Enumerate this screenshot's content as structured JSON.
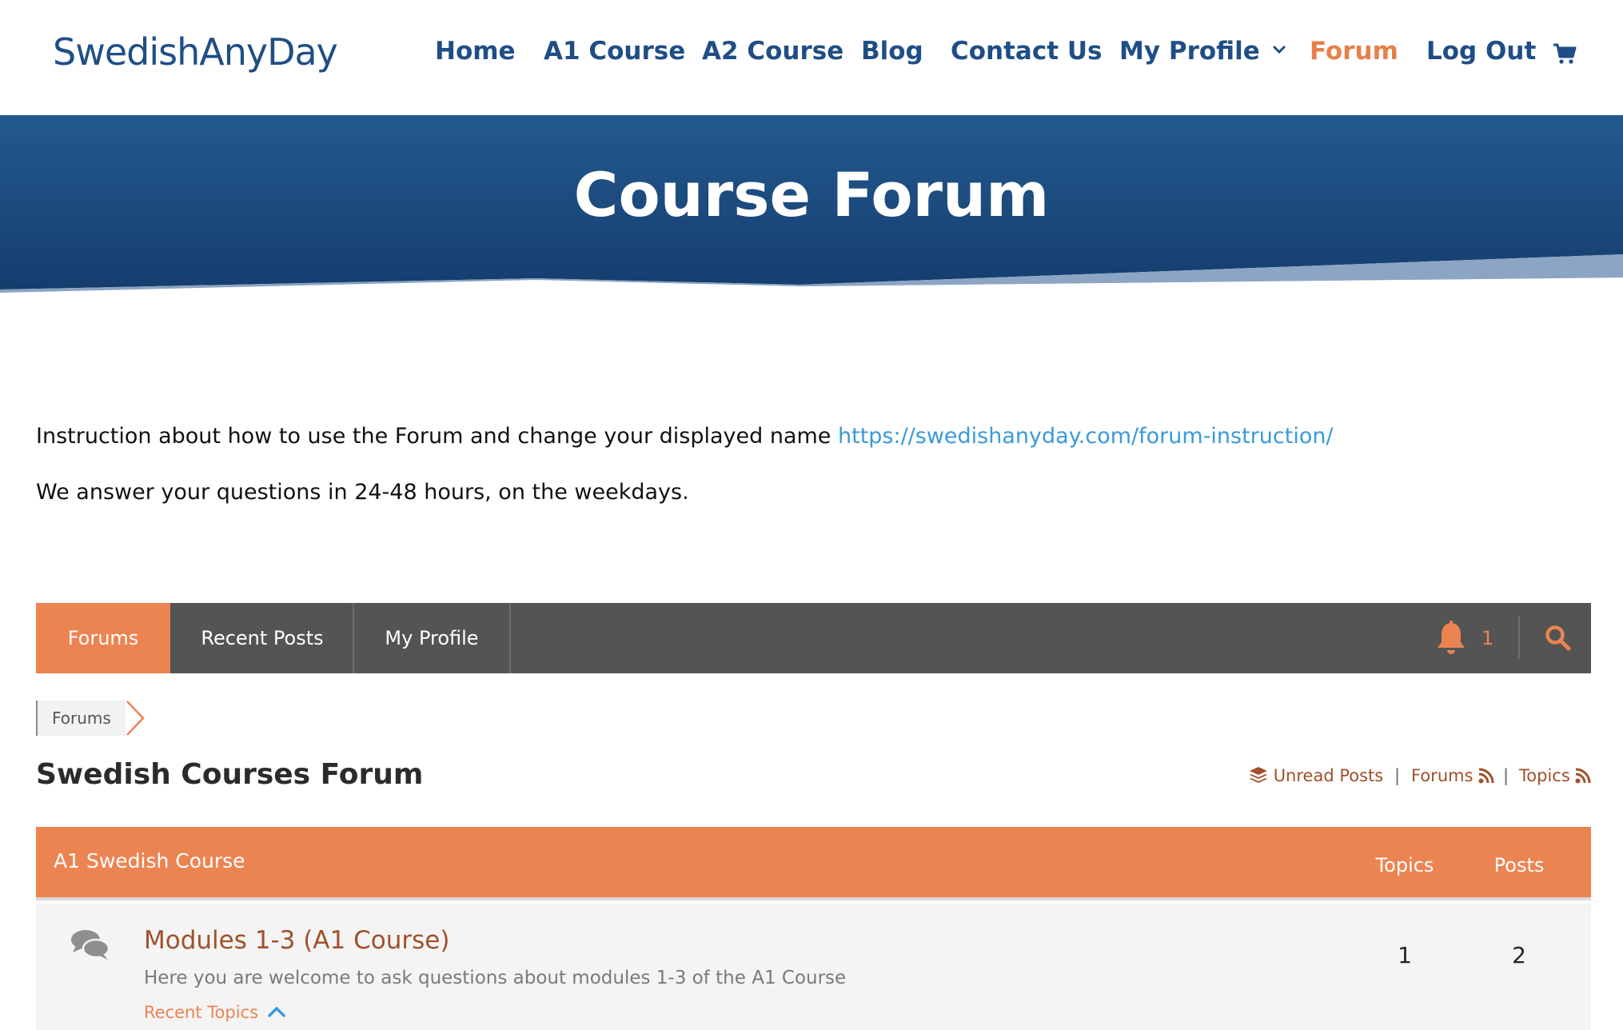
{
  "site": {
    "logo": "SwedishAnyDay"
  },
  "nav": {
    "items": [
      {
        "label": "Home"
      },
      {
        "label": "A1 Course"
      },
      {
        "label": "A2 Course"
      },
      {
        "label": "Blog"
      },
      {
        "label": "Contact Us"
      },
      {
        "label": "My Profile"
      },
      {
        "label": "Forum"
      },
      {
        "label": "Log Out"
      }
    ],
    "active": "Forum",
    "cart_icon": "cart-icon"
  },
  "hero": {
    "title": "Course Forum"
  },
  "intro": {
    "instruction_text": "Instruction about how to use the Forum and change your displayed name",
    "instruction_link": "https://swedishanyday.com/forum-instruction/",
    "response_text": "We answer your questions in 24-48 hours, on the weekdays."
  },
  "forum_bar": {
    "tabs": [
      {
        "label": "Forums"
      },
      {
        "label": "Recent Posts"
      },
      {
        "label": "My Profile"
      }
    ],
    "active_tab": "Forums",
    "notification_count": "1",
    "bell_icon": "bell-icon",
    "search_icon": "search-icon"
  },
  "breadcrumb": {
    "items": [
      "Forums"
    ]
  },
  "forum": {
    "heading": "Swedish Courses Forum",
    "links": {
      "unread": "Unread Posts",
      "forums": "Forums",
      "topics": "Topics",
      "separator": "|"
    }
  },
  "category": {
    "title": "A1 Swedish Course",
    "col_topics": "Topics",
    "col_posts": "Posts",
    "forums": [
      {
        "title": "Modules 1-3 (A1 Course)",
        "description": "Here you are welcome to ask questions about modules 1-3 of the A1 Course",
        "recent_label": "Recent Topics",
        "topics": "1",
        "posts": "2"
      }
    ]
  },
  "colors": {
    "brand_blue": "#1f4e86",
    "accent_orange": "#ec8452",
    "link_blue": "#3a9ad9",
    "link_brown": "#a0502a",
    "bar_gray": "#545454"
  }
}
